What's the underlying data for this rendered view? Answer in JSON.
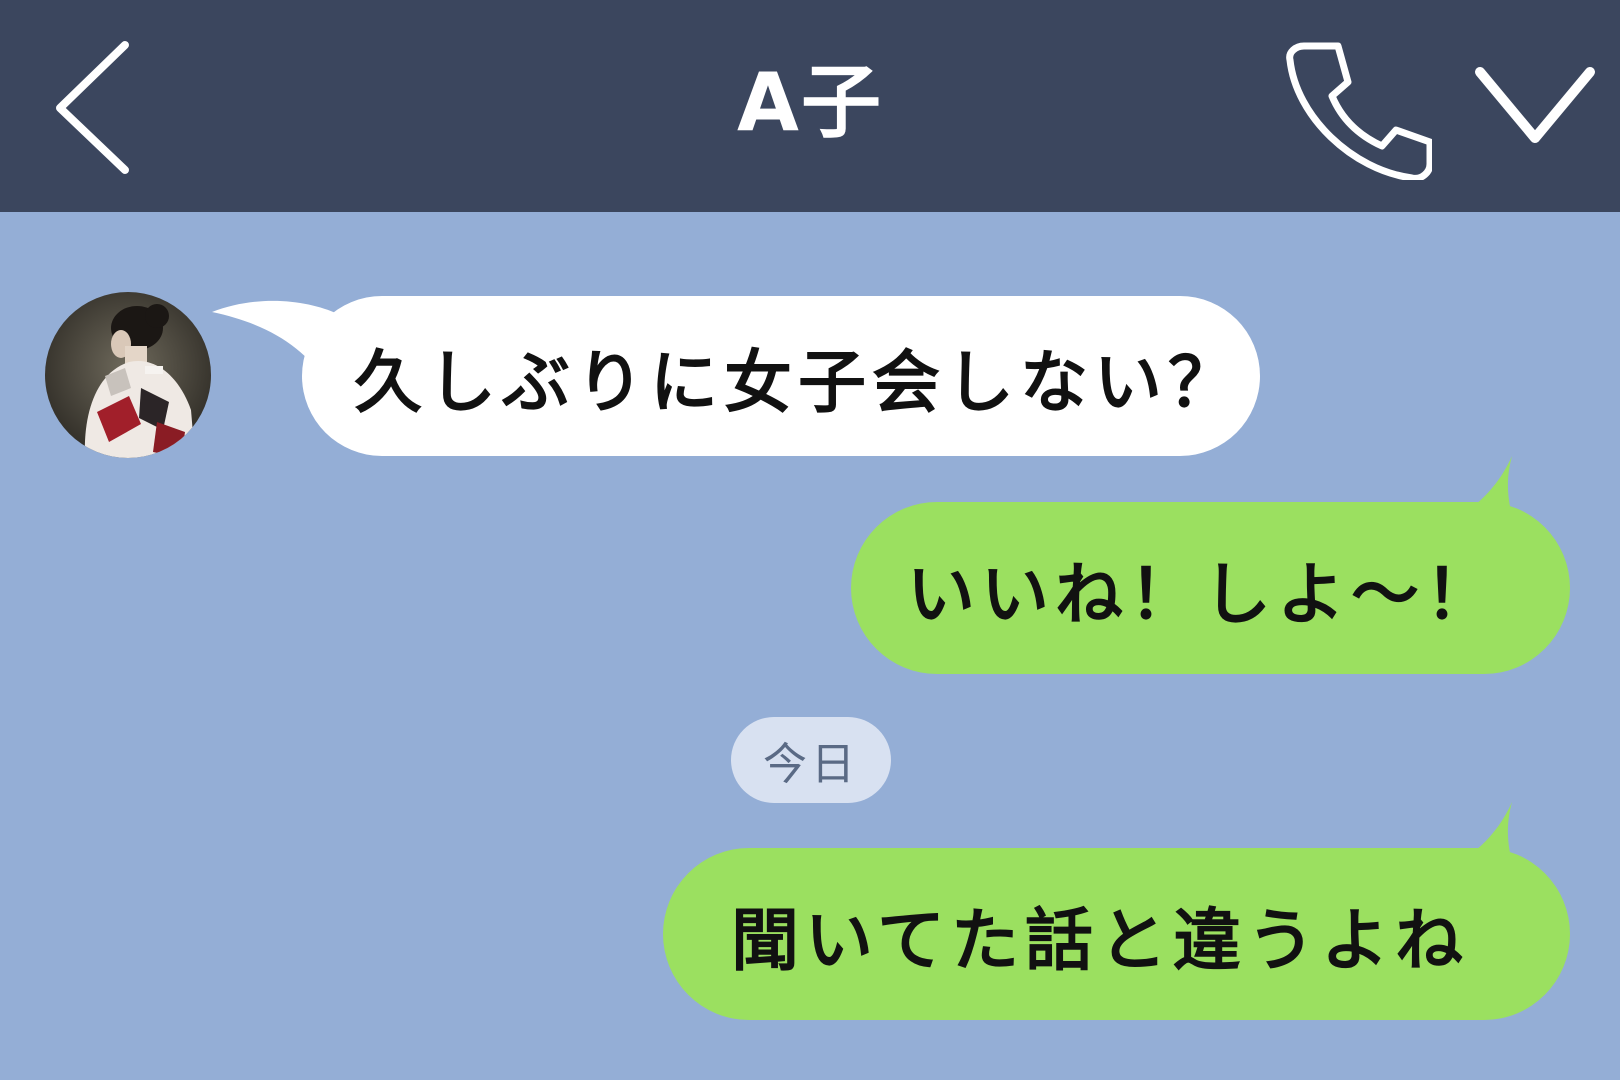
{
  "header": {
    "title": "A子",
    "back_icon": "chevron-left-icon",
    "call_icon": "phone-icon",
    "menu_icon": "chevron-down-icon"
  },
  "colors": {
    "header_bg": "#3b465e",
    "chat_bg": "#94aed6",
    "incoming_bubble": "#ffffff",
    "outgoing_bubble": "#9be060",
    "date_pill": "#d8e1f1"
  },
  "messages": [
    {
      "direction": "incoming",
      "text": "久しぶりに女子会しない？"
    },
    {
      "direction": "outgoing",
      "text": "いいね！しよ〜！"
    },
    {
      "direction": "outgoing",
      "text": "聞いてた話と違うよね"
    }
  ],
  "date_separator": "今日"
}
